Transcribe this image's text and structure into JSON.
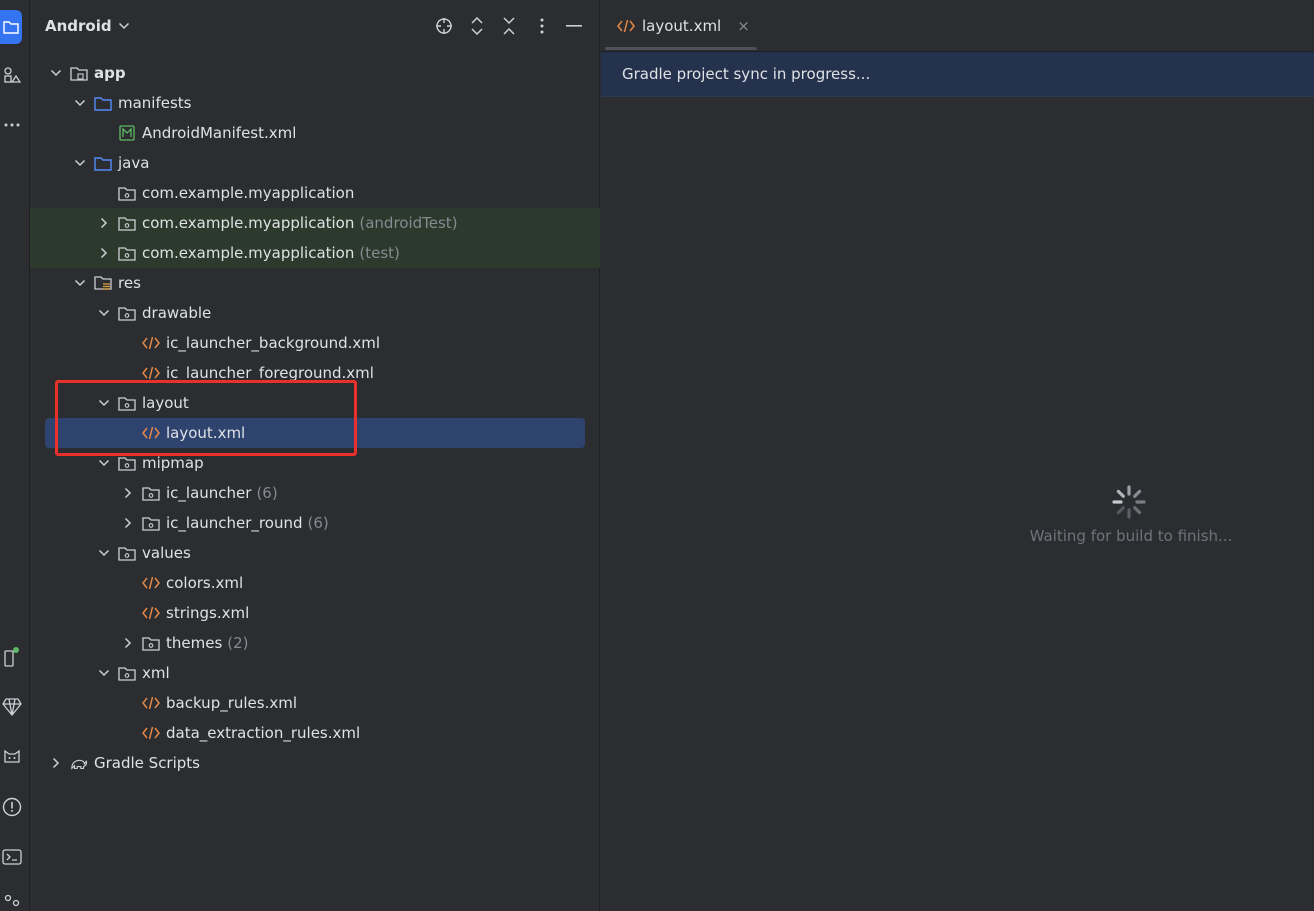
{
  "panel": {
    "title": "Android"
  },
  "tree": [
    {
      "label": "app",
      "suffix": "",
      "chevron": "down",
      "icon": "module-folder-icon",
      "indent": 0,
      "bold": true,
      "state": ""
    },
    {
      "label": "manifests",
      "suffix": "",
      "chevron": "down",
      "icon": "folder-icon",
      "indent": 1,
      "bold": false,
      "state": ""
    },
    {
      "label": "AndroidManifest.xml",
      "suffix": "",
      "chevron": "none",
      "icon": "manifest-file-icon",
      "indent": 2,
      "bold": false,
      "state": ""
    },
    {
      "label": "java",
      "suffix": "",
      "chevron": "down",
      "icon": "folder-icon",
      "indent": 1,
      "bold": false,
      "state": ""
    },
    {
      "label": "com.example.myapplication",
      "suffix": "",
      "chevron": "none",
      "icon": "package-icon",
      "indent": 2,
      "bold": false,
      "state": ""
    },
    {
      "label": "com.example.myapplication",
      "suffix": "(androidTest)",
      "chevron": "right",
      "icon": "package-icon",
      "indent": 2,
      "bold": false,
      "state": "green"
    },
    {
      "label": "com.example.myapplication",
      "suffix": "(test)",
      "chevron": "right",
      "icon": "package-icon",
      "indent": 2,
      "bold": false,
      "state": "green"
    },
    {
      "label": "res",
      "suffix": "",
      "chevron": "down",
      "icon": "resource-folder-icon",
      "indent": 1,
      "bold": false,
      "state": ""
    },
    {
      "label": "drawable",
      "suffix": "",
      "chevron": "down",
      "icon": "package-icon",
      "indent": 2,
      "bold": false,
      "state": ""
    },
    {
      "label": "ic_launcher_background.xml",
      "suffix": "",
      "chevron": "none",
      "icon": "xml-file-icon",
      "indent": 3,
      "bold": false,
      "state": ""
    },
    {
      "label": "ic_launcher_foreground.xml",
      "suffix": "",
      "chevron": "none",
      "icon": "xml-file-icon",
      "indent": 3,
      "bold": false,
      "state": ""
    },
    {
      "label": "layout",
      "suffix": "",
      "chevron": "down",
      "icon": "package-icon",
      "indent": 2,
      "bold": false,
      "state": ""
    },
    {
      "label": "layout.xml",
      "suffix": "",
      "chevron": "none",
      "icon": "xml-file-icon",
      "indent": 3,
      "bold": false,
      "state": "selected"
    },
    {
      "label": "mipmap",
      "suffix": "",
      "chevron": "down",
      "icon": "package-icon",
      "indent": 2,
      "bold": false,
      "state": ""
    },
    {
      "label": "ic_launcher",
      "suffix": "(6)",
      "chevron": "right",
      "icon": "package-icon",
      "indent": 3,
      "bold": false,
      "state": ""
    },
    {
      "label": "ic_launcher_round",
      "suffix": "(6)",
      "chevron": "right",
      "icon": "package-icon",
      "indent": 3,
      "bold": false,
      "state": ""
    },
    {
      "label": "values",
      "suffix": "",
      "chevron": "down",
      "icon": "package-icon",
      "indent": 2,
      "bold": false,
      "state": ""
    },
    {
      "label": "colors.xml",
      "suffix": "",
      "chevron": "none",
      "icon": "xml-file-icon",
      "indent": 3,
      "bold": false,
      "state": ""
    },
    {
      "label": "strings.xml",
      "suffix": "",
      "chevron": "none",
      "icon": "xml-file-icon",
      "indent": 3,
      "bold": false,
      "state": ""
    },
    {
      "label": "themes",
      "suffix": "(2)",
      "chevron": "right",
      "icon": "package-icon",
      "indent": 3,
      "bold": false,
      "state": ""
    },
    {
      "label": "xml",
      "suffix": "",
      "chevron": "down",
      "icon": "package-icon",
      "indent": 2,
      "bold": false,
      "state": ""
    },
    {
      "label": "backup_rules.xml",
      "suffix": "",
      "chevron": "none",
      "icon": "xml-file-icon",
      "indent": 3,
      "bold": false,
      "state": ""
    },
    {
      "label": "data_extraction_rules.xml",
      "suffix": "",
      "chevron": "none",
      "icon": "xml-file-icon",
      "indent": 3,
      "bold": false,
      "state": ""
    },
    {
      "label": "Gradle Scripts",
      "suffix": "",
      "chevron": "right",
      "icon": "gradle-icon",
      "indent": 0,
      "bold": false,
      "state": ""
    }
  ],
  "editor": {
    "tab_label": "layout.xml",
    "tab_close": "×",
    "banner": "Gradle project sync in progress...",
    "waiting": "Waiting for build to finish..."
  },
  "colors": {
    "accent": "#3574f0",
    "xml_icon": "#e4884a",
    "folder_icon": "#548af7",
    "manifest_icon": "#5fb865",
    "highlight": "#e9302a"
  }
}
